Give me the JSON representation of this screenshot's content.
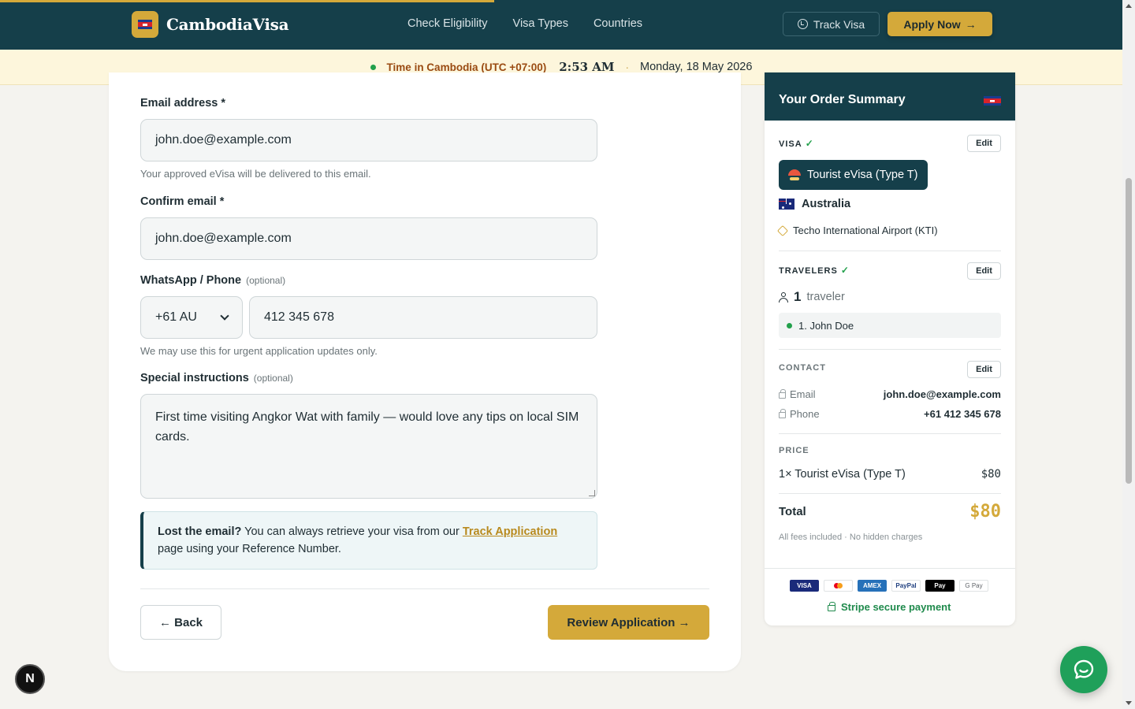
{
  "header": {
    "brand": "CambodiaVisa",
    "nav": [
      "Check Eligibility",
      "Visa Types",
      "Countries"
    ],
    "track_label": "Track Visa",
    "apply_label": "Apply Now",
    "apply_arrow": "→"
  },
  "timebar": {
    "timezone": "Time in Cambodia (UTC +07:00)",
    "time": "2:53 AM",
    "separator": "·",
    "date": "Monday, 18 May 2026"
  },
  "form": {
    "email_label": "Email address *",
    "email_value": "john.doe@example.com",
    "email_hint": "Your approved eVisa will be delivered to this email.",
    "confirm_label": "Confirm email *",
    "confirm_value": "john.doe@example.com",
    "phone_label": "WhatsApp / Phone",
    "phone_optional": "(optional)",
    "phone_code": "+61 AU",
    "phone_value": "412 345 678",
    "phone_hint": "We may use this for urgent application updates only.",
    "instructions_label": "Special instructions",
    "instructions_optional": "(optional)",
    "instructions_value": "First time visiting Angkor Wat with family — would love any tips on local SIM cards.",
    "notice_bold": "Lost the email?",
    "notice_text": "You can always retrieve your visa from our",
    "notice_link": "Track Application",
    "notice_tail": "page using your Reference Number.",
    "back_label": "← Back",
    "review_label": "Review Application →"
  },
  "summary": {
    "title": "Your Order Summary",
    "visa_label": "VISA",
    "check": "✓",
    "edit": "Edit",
    "visa_type": "Tourist eVisa (Type T)",
    "country": "Australia",
    "airport": "Techo International Airport (KTI)",
    "travelers_label": "TRAVELERS",
    "traveler_count": "1",
    "traveler_word": "traveler",
    "traveler_1": "1. John Doe",
    "contact_label": "CONTACT",
    "email_key": "Email",
    "email_val": "john.doe@example.com",
    "phone_key": "Phone",
    "phone_val": "+61 412 345 678",
    "price_label": "PRICE",
    "price_item": "1× Tourist eVisa (Type T)",
    "price_value": "$80",
    "total_label": "Total",
    "total_value": "$80",
    "fees_note": "All fees included · No hidden charges",
    "payment_logos": [
      "VISA",
      "AMEX",
      "PayPal",
      " Pay",
      "G Pay"
    ],
    "secure_label": "Stripe secure payment"
  },
  "misc": {
    "n_badge": "N"
  },
  "colors": {
    "brand_dark": "#153f4a",
    "accent_gold": "#d4a93a",
    "success_green": "#22a04b"
  }
}
